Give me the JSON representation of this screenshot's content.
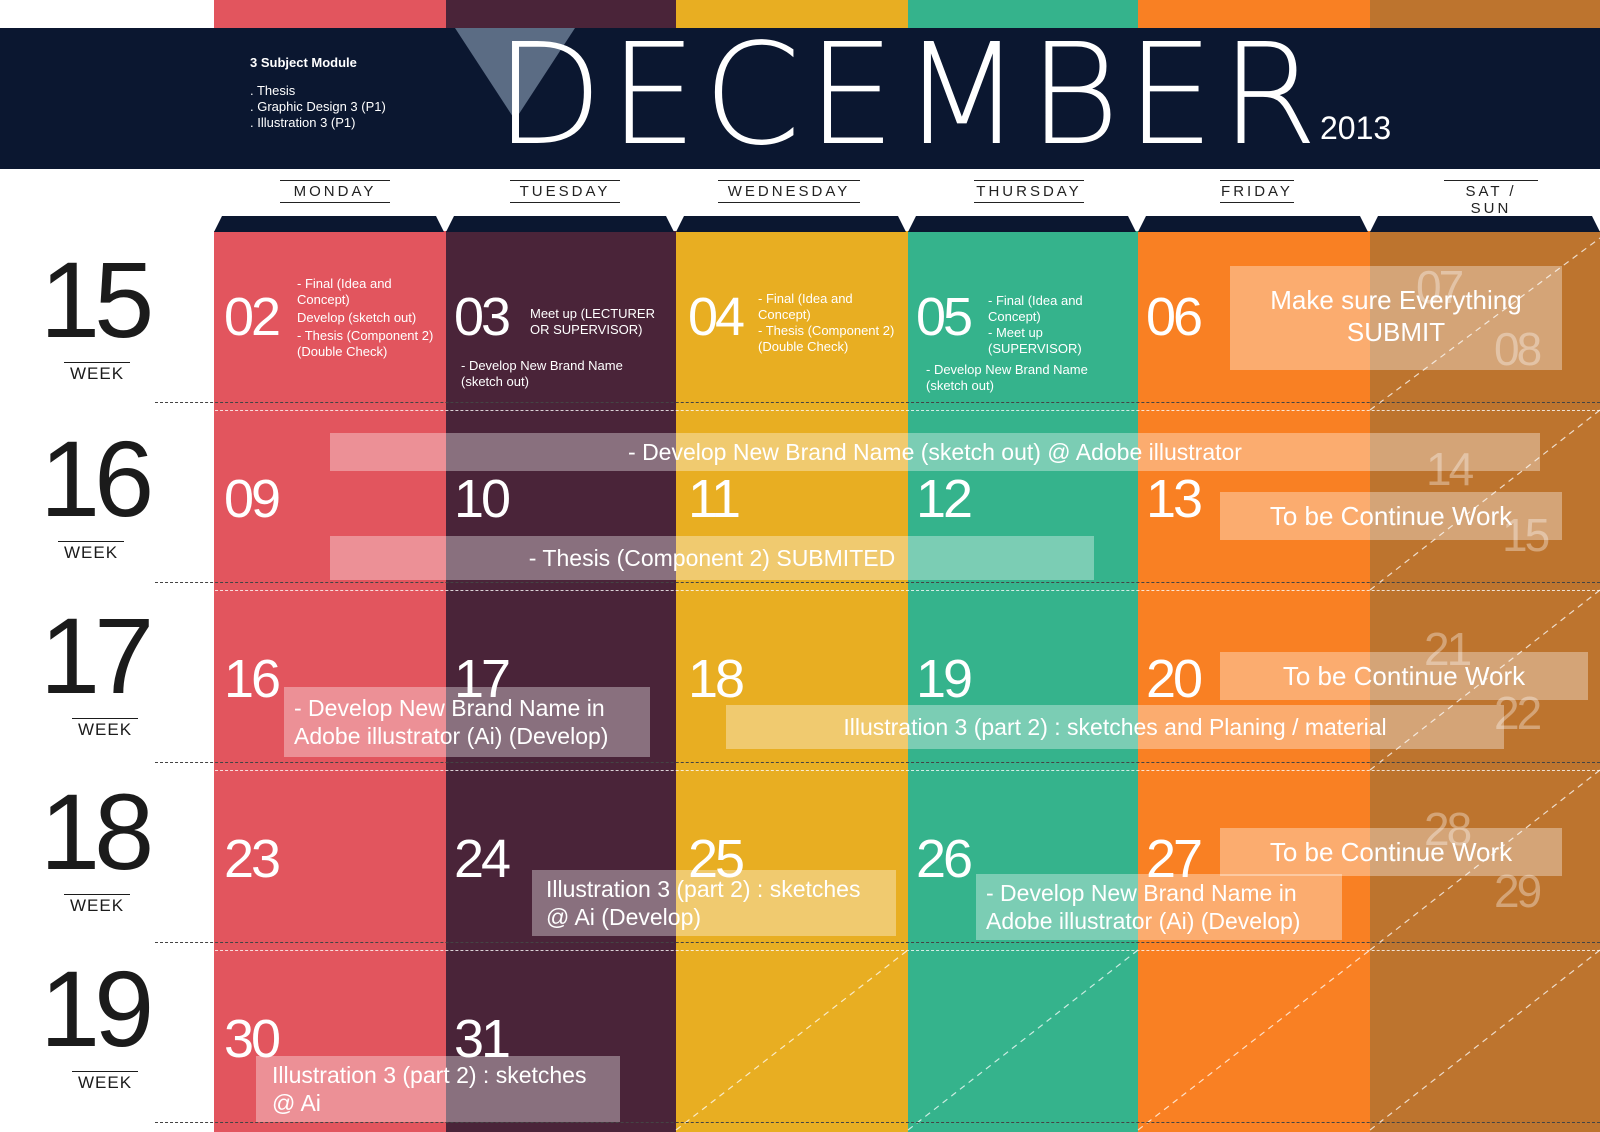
{
  "header": {
    "month": "DECEMBER",
    "year": "2013",
    "module_title": "3 Subject Module",
    "module_items": [
      ". Thesis",
      ". Graphic Design 3 (P1)",
      ". Illustration 3 (P1)"
    ]
  },
  "colors": {
    "header_bg": "#0b1730",
    "monday": "#e2555e",
    "tuesday": "#4a2439",
    "wednesday": "#e8ae22",
    "thursday": "#35b38c",
    "friday": "#f98023",
    "weekend": "#bd742e"
  },
  "days": [
    "MONDAY",
    "TUESDAY",
    "WEDNESDAY",
    "THURSDAY",
    "FRIDAY",
    "SAT / SUN"
  ],
  "week_label": "WEEK",
  "weeks": [
    "15",
    "16",
    "17",
    "18",
    "19"
  ],
  "dates": {
    "w1": [
      "02",
      "03",
      "04",
      "05",
      "06"
    ],
    "w1_weekend": [
      "07",
      "08"
    ],
    "w2": [
      "09",
      "10",
      "11",
      "12",
      "13"
    ],
    "w2_weekend": [
      "14",
      "15"
    ],
    "w3": [
      "16",
      "17",
      "18",
      "19",
      "20"
    ],
    "w3_weekend": [
      "21",
      "22"
    ],
    "w4": [
      "23",
      "24",
      "25",
      "26",
      "27"
    ],
    "w4_weekend": [
      "28",
      "29"
    ],
    "w5": [
      "30",
      "31"
    ]
  },
  "notes": {
    "mon_02": [
      "- Final (Idea and",
      "Concept)",
      "Develop (sketch out)",
      "- Thesis (Component 2)",
      "(Double Check)"
    ],
    "tue_03_a": [
      "Meet up (LECTURER",
      "OR SUPERVISOR)"
    ],
    "tue_03_b": [
      "- Develop New Brand Name",
      "(sketch out)"
    ],
    "wed_04": [
      "- Final (Idea and",
      "Concept)",
      "- Thesis (Component 2)",
      "(Double Check)"
    ],
    "thu_05": [
      "- Final (Idea and",
      "Concept)",
      "- Meet up",
      "(SUPERVISOR)"
    ],
    "thu_05_b": [
      "- Develop New Brand Name",
      "(sketch out)"
    ]
  },
  "bars": {
    "submit": [
      "Make sure Everything",
      "SUBMIT"
    ],
    "brand_ai": "- Develop New Brand Name (sketch out) @ Adobe illustrator",
    "thesis": "- Thesis (Component 2) SUBMITED",
    "continue_1": "To be Continue Work",
    "continue_2": "To be Continue Work",
    "continue_3": "To be Continue Work",
    "brand_develop_1": [
      "- Develop New Brand Name in",
      "Adobe illustrator (Ai) (Develop)"
    ],
    "illus_planing": "Illustration 3 (part 2) : sketches and Planing / material",
    "illus_develop": [
      "Illustration 3 (part 2) : sketches",
      "@ Ai (Develop)"
    ],
    "brand_develop_2": [
      "- Develop New Brand Name in",
      "Adobe illustrator (Ai) (Develop)"
    ],
    "illus_ai": [
      "Illustration 3 (part 2) : sketches",
      "@ Ai"
    ]
  }
}
